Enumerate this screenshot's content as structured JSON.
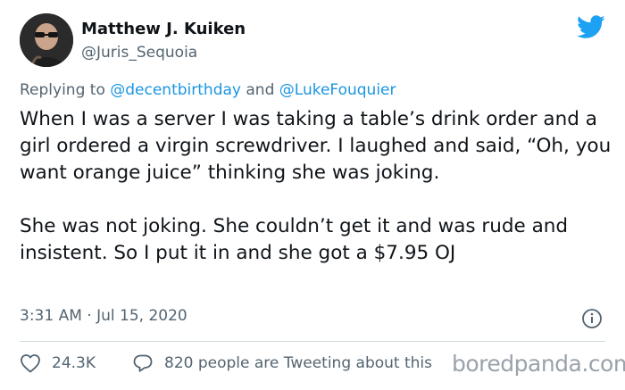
{
  "author": {
    "name": "Matthew J. Kuiken",
    "handle": "@Juris_Sequoia"
  },
  "reply": {
    "prefix": "Replying to",
    "mention_1": "@decentbirthday",
    "conjunction": "and",
    "mention_2": "@LukeFouquier"
  },
  "tweet": {
    "text": "When I was a server I was taking a table’s drink order and a girl ordered a virgin screwdriver. I laughed and said, “Oh, you want orange juice” thinking she was joking.\n\nShe was not joking. She couldn’t get it and was rude and insistent. So I put it in and she got a $7.95 OJ",
    "timestamp": "3:31 AM · Jul 15, 2020"
  },
  "actions": {
    "likes": "24.3K",
    "tweeting_about": "820 people are Tweeting about this"
  },
  "watermark": "boredpanda.com",
  "icons": {
    "brand": "twitter-bird-icon",
    "info": "info-icon",
    "like": "heart-icon",
    "reply": "speech-bubble-icon"
  },
  "colors": {
    "brand": "#1da1f2",
    "mention": "#1b95e0",
    "secondary_text": "#536471",
    "primary_text": "#0f1419"
  }
}
